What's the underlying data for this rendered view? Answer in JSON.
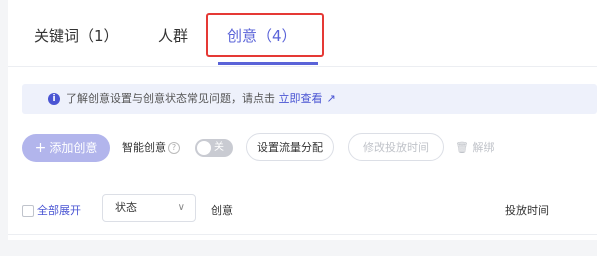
{
  "tabs": [
    {
      "label": "关键词（1）"
    },
    {
      "label": "人群"
    },
    {
      "label": "创意（4）"
    }
  ],
  "notice": {
    "text": "了解创意设置与创意状态常见问题，请点击",
    "link": "立即查看"
  },
  "toolbar": {
    "add_label": "添加创意",
    "smart_label": "智能创意",
    "toggle_label": "关",
    "flow_label": "设置流量分配",
    "time_label": "修改投放时间",
    "unbind_label": "解绑"
  },
  "table": {
    "expand_all": "全部展开",
    "status_value": "状态",
    "columns": [
      "创意",
      "投放时间"
    ]
  },
  "colors": {
    "accent": "#5a63d8",
    "highlight": "#e53935"
  }
}
